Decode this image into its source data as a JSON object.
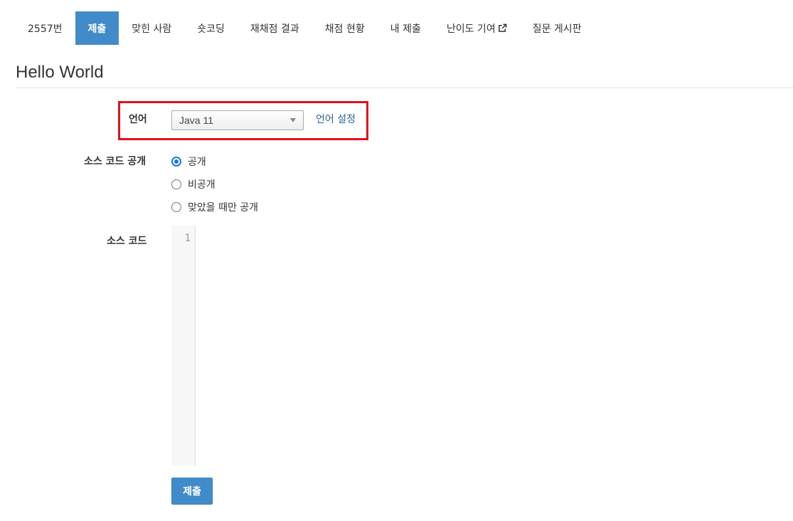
{
  "nav": {
    "items": [
      {
        "label": "2557번"
      },
      {
        "label": "제출"
      },
      {
        "label": "맞힌 사람"
      },
      {
        "label": "숏코딩"
      },
      {
        "label": "재채점 결과"
      },
      {
        "label": "채점 현황"
      },
      {
        "label": "내 제출"
      },
      {
        "label": "난이도 기여",
        "icon": "external-link-icon"
      },
      {
        "label": "질문 게시판"
      }
    ],
    "active_index": 1
  },
  "problem": {
    "title": "Hello World"
  },
  "form": {
    "language": {
      "label": "언어",
      "selected": "Java 11",
      "settings_link": "언어 설정"
    },
    "visibility": {
      "label": "소스 코드 공개",
      "options": [
        "공개",
        "비공개",
        "맞았을 때만 공개"
      ],
      "selected_index": 0
    },
    "source": {
      "label": "소스 코드",
      "line_numbers": [
        "1"
      ]
    },
    "submit_label": "제출"
  },
  "colors": {
    "primary": "#428bca",
    "highlight_border": "#e3101a",
    "link": "#2a6496"
  }
}
